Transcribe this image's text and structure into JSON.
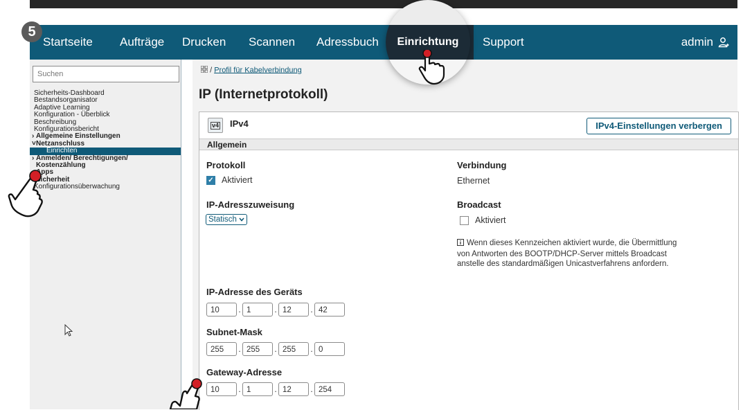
{
  "step_number": "5",
  "nav": {
    "items": [
      "Startseite",
      "Aufträge",
      "Drucken",
      "Scannen",
      "Adressbuch",
      "Einrichtung",
      "Support"
    ],
    "active": "Einrichtung",
    "user": "admin",
    "user_icon": "user-icon"
  },
  "sidebar": {
    "search_placeholder": "Suchen",
    "items": [
      "Sicherheits-Dashboard",
      "Bestandsorganisator",
      "Adaptive Learning",
      "Konfiguration - Überblick",
      "Beschreibung",
      "Konfigurationsbericht",
      "Allgemeine Einstellungen",
      "Netzanschluss",
      "Einrichten",
      "Anmelden/ Berechtigungen/",
      "Kostenzählung",
      "Apps",
      "Sicherheit",
      "Konfigurationsüberwachung"
    ],
    "selected": "Einrichten",
    "accent": "#0f5a78"
  },
  "breadcrumb": {
    "icon": "grid-icon",
    "separator": "/",
    "link": "Profil für Kabelverbindung"
  },
  "page_title": "IP (Internetprotokoll)",
  "card": {
    "badge": "v4",
    "title": "IPv4",
    "toggle_button": "IPv4-Einstellungen verbergen",
    "section": "Allgemein",
    "protokoll": {
      "label": "Protokoll",
      "checkbox_label": "Aktiviert",
      "checked": true
    },
    "verbindung": {
      "label": "Verbindung",
      "value": "Ethernet"
    },
    "ip_assignment": {
      "label": "IP-Adresszuweisung",
      "value": "Statisch"
    },
    "broadcast": {
      "label": "Broadcast",
      "checkbox_label": "Aktiviert",
      "checked": false,
      "info_icon": "info-icon",
      "info": "Wenn dieses Kennzeichen aktiviert wurde, die Übermittlung von Antworten des BOOTP/DHCP-Server mittels Broadcast anstelle des standardmäßigen Unicastverfahrens anfordern."
    },
    "ip_address": {
      "label": "IP-Adresse des Geräts",
      "octets": [
        "10",
        "1",
        "12",
        "42"
      ]
    },
    "subnet": {
      "label": "Subnet-Mask",
      "octets": [
        "255",
        "255",
        "255",
        "0"
      ]
    },
    "gateway": {
      "label": "Gateway-Adresse",
      "octets": [
        "10",
        "1",
        "12",
        "254"
      ]
    }
  }
}
